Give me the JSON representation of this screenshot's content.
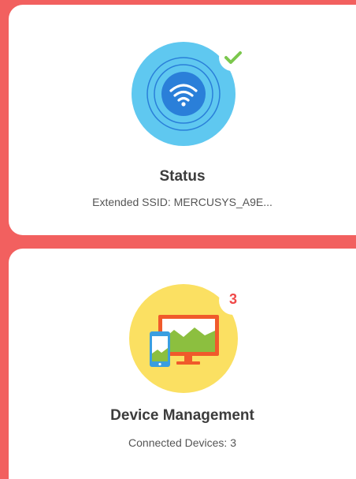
{
  "status_card": {
    "title": "Status",
    "subtitle": "Extended SSID: MERCUSYS_A9E...",
    "icon": "wifi-icon",
    "badge_icon": "checkmark-icon"
  },
  "devices_card": {
    "title": "Device Management",
    "subtitle": "Connected Devices: 3",
    "icon": "devices-icon",
    "badge_count": "3"
  },
  "colors": {
    "background": "#f2605f",
    "wifi_circle_outer": "#5fc8f0",
    "wifi_circle_inner": "#2a7fd9",
    "check": "#7bc74d",
    "devices_circle": "#fbe062",
    "monitor": "#f05a2b",
    "badge_text": "#f04848"
  }
}
